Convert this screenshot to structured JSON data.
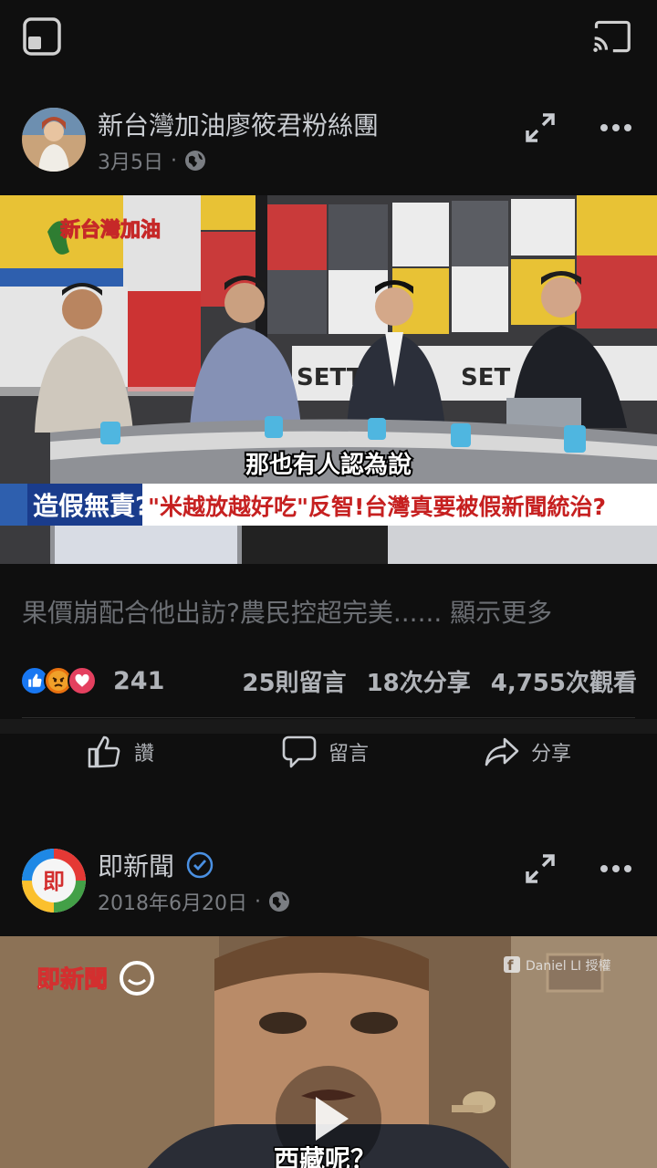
{
  "topbar": {
    "left_icon": "pip-icon",
    "right_icon": "cast-icon"
  },
  "post1": {
    "author": "新台灣加油廖筱君粉絲團",
    "date": "3月5日",
    "separator": "·",
    "privacy_icon": "globe-icon",
    "video": {
      "show_logo": "新台灣加油",
      "station": "SETTV",
      "subtitle": "那也有人認為說",
      "banner_left": "造假無責?",
      "banner_right": "\"米越放越好吃\"反智!台灣真要被假新聞統治?"
    },
    "caption": "果價崩配合他出訪?農民控超完美......",
    "see_more": "顯示更多",
    "reactions_count": "241",
    "comments": "25則留言",
    "shares": "18次分享",
    "views": "4,755次觀看",
    "like_label": "讚",
    "comment_label": "留言",
    "share_label": "分享"
  },
  "post2": {
    "author": "即新聞",
    "date": "2018年6月20日",
    "separator": "·",
    "privacy_icon": "globe-icon",
    "video": {
      "brand": "即新聞",
      "credit": "Daniel LI 授權",
      "subtitle": "西藏呢？"
    }
  },
  "colors": {
    "background": "#0f0f0f",
    "accent_blue": "#1877f2",
    "verified": "#4a90e2"
  }
}
